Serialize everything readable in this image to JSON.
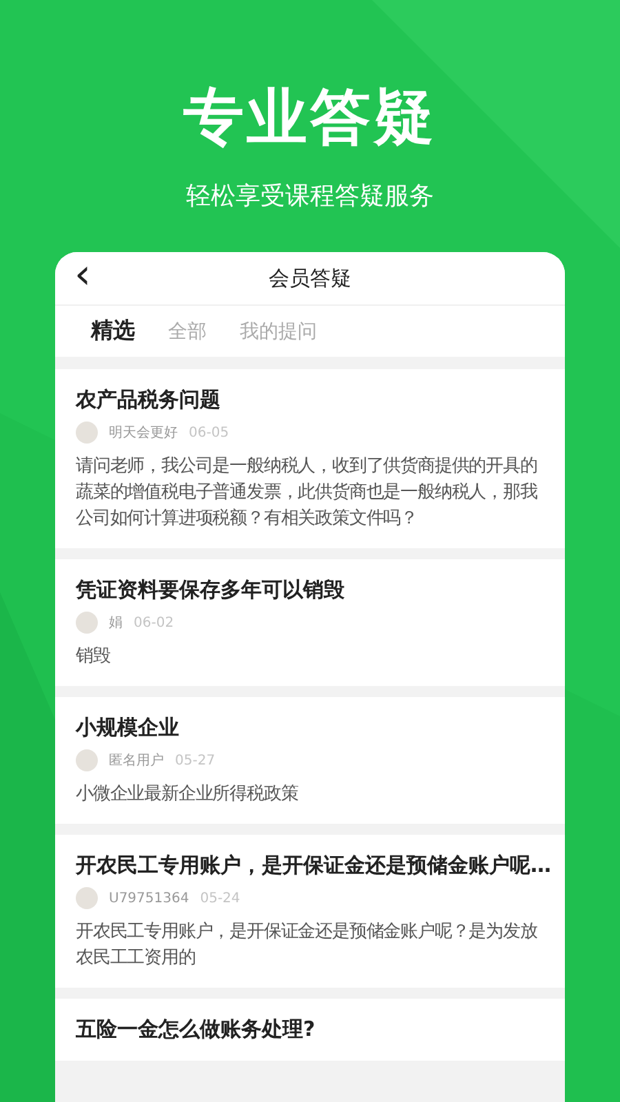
{
  "hero": {
    "title": "专业答疑",
    "subtitle": "轻松享受课程答疑服务"
  },
  "nav": {
    "back": "‹",
    "title": "会员答疑"
  },
  "tabs": [
    {
      "label": "精选",
      "selected": true
    },
    {
      "label": "全部",
      "selected": false
    },
    {
      "label": "我的提问",
      "selected": false
    }
  ],
  "posts": [
    {
      "title": "农产品税务问题",
      "author": "明天会更好",
      "date": "06-05",
      "body": "请问老师，我公司是一般纳税人，收到了供货商提供的开具的蔬菜的增值税电子普通发票，此供货商也是一般纳税人，那我公司如何计算进项税额？有相关政策文件吗？"
    },
    {
      "title": "凭证资料要保存多年可以销毁",
      "author": "娟",
      "date": "06-02",
      "body": "销毁"
    },
    {
      "title": "小规模企业",
      "author": "匿名用户",
      "date": "05-27",
      "body": "小微企业最新企业所得税政策"
    },
    {
      "title": "开农民工专用账户，是开保证金还是预储金账户呢…",
      "author": "U79751364",
      "date": "05-24",
      "body": "开农民工专用账户，是开保证金还是预储金账户呢？是为发放农民工工资用的"
    },
    {
      "title": "五险一金怎么做账务处理?"
    }
  ]
}
